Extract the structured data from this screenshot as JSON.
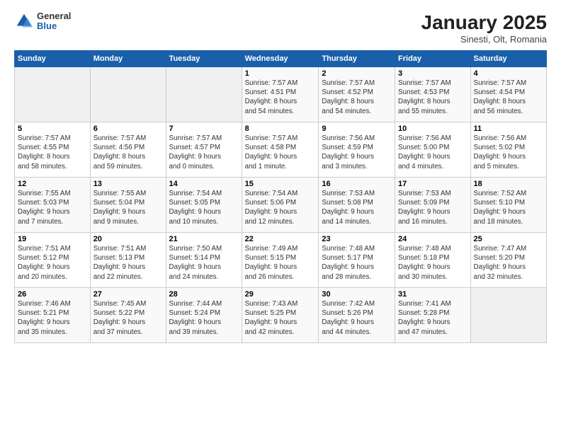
{
  "header": {
    "logo_general": "General",
    "logo_blue": "Blue",
    "month": "January 2025",
    "location": "Sinesti, Olt, Romania"
  },
  "weekdays": [
    "Sunday",
    "Monday",
    "Tuesday",
    "Wednesday",
    "Thursday",
    "Friday",
    "Saturday"
  ],
  "weeks": [
    [
      {
        "day": "",
        "info": ""
      },
      {
        "day": "",
        "info": ""
      },
      {
        "day": "",
        "info": ""
      },
      {
        "day": "1",
        "info": "Sunrise: 7:57 AM\nSunset: 4:51 PM\nDaylight: 8 hours\nand 54 minutes."
      },
      {
        "day": "2",
        "info": "Sunrise: 7:57 AM\nSunset: 4:52 PM\nDaylight: 8 hours\nand 54 minutes."
      },
      {
        "day": "3",
        "info": "Sunrise: 7:57 AM\nSunset: 4:53 PM\nDaylight: 8 hours\nand 55 minutes."
      },
      {
        "day": "4",
        "info": "Sunrise: 7:57 AM\nSunset: 4:54 PM\nDaylight: 8 hours\nand 56 minutes."
      }
    ],
    [
      {
        "day": "5",
        "info": "Sunrise: 7:57 AM\nSunset: 4:55 PM\nDaylight: 8 hours\nand 58 minutes."
      },
      {
        "day": "6",
        "info": "Sunrise: 7:57 AM\nSunset: 4:56 PM\nDaylight: 8 hours\nand 59 minutes."
      },
      {
        "day": "7",
        "info": "Sunrise: 7:57 AM\nSunset: 4:57 PM\nDaylight: 9 hours\nand 0 minutes."
      },
      {
        "day": "8",
        "info": "Sunrise: 7:57 AM\nSunset: 4:58 PM\nDaylight: 9 hours\nand 1 minute."
      },
      {
        "day": "9",
        "info": "Sunrise: 7:56 AM\nSunset: 4:59 PM\nDaylight: 9 hours\nand 3 minutes."
      },
      {
        "day": "10",
        "info": "Sunrise: 7:56 AM\nSunset: 5:00 PM\nDaylight: 9 hours\nand 4 minutes."
      },
      {
        "day": "11",
        "info": "Sunrise: 7:56 AM\nSunset: 5:02 PM\nDaylight: 9 hours\nand 5 minutes."
      }
    ],
    [
      {
        "day": "12",
        "info": "Sunrise: 7:55 AM\nSunset: 5:03 PM\nDaylight: 9 hours\nand 7 minutes."
      },
      {
        "day": "13",
        "info": "Sunrise: 7:55 AM\nSunset: 5:04 PM\nDaylight: 9 hours\nand 9 minutes."
      },
      {
        "day": "14",
        "info": "Sunrise: 7:54 AM\nSunset: 5:05 PM\nDaylight: 9 hours\nand 10 minutes."
      },
      {
        "day": "15",
        "info": "Sunrise: 7:54 AM\nSunset: 5:06 PM\nDaylight: 9 hours\nand 12 minutes."
      },
      {
        "day": "16",
        "info": "Sunrise: 7:53 AM\nSunset: 5:08 PM\nDaylight: 9 hours\nand 14 minutes."
      },
      {
        "day": "17",
        "info": "Sunrise: 7:53 AM\nSunset: 5:09 PM\nDaylight: 9 hours\nand 16 minutes."
      },
      {
        "day": "18",
        "info": "Sunrise: 7:52 AM\nSunset: 5:10 PM\nDaylight: 9 hours\nand 18 minutes."
      }
    ],
    [
      {
        "day": "19",
        "info": "Sunrise: 7:51 AM\nSunset: 5:12 PM\nDaylight: 9 hours\nand 20 minutes."
      },
      {
        "day": "20",
        "info": "Sunrise: 7:51 AM\nSunset: 5:13 PM\nDaylight: 9 hours\nand 22 minutes."
      },
      {
        "day": "21",
        "info": "Sunrise: 7:50 AM\nSunset: 5:14 PM\nDaylight: 9 hours\nand 24 minutes."
      },
      {
        "day": "22",
        "info": "Sunrise: 7:49 AM\nSunset: 5:15 PM\nDaylight: 9 hours\nand 26 minutes."
      },
      {
        "day": "23",
        "info": "Sunrise: 7:48 AM\nSunset: 5:17 PM\nDaylight: 9 hours\nand 28 minutes."
      },
      {
        "day": "24",
        "info": "Sunrise: 7:48 AM\nSunset: 5:18 PM\nDaylight: 9 hours\nand 30 minutes."
      },
      {
        "day": "25",
        "info": "Sunrise: 7:47 AM\nSunset: 5:20 PM\nDaylight: 9 hours\nand 32 minutes."
      }
    ],
    [
      {
        "day": "26",
        "info": "Sunrise: 7:46 AM\nSunset: 5:21 PM\nDaylight: 9 hours\nand 35 minutes."
      },
      {
        "day": "27",
        "info": "Sunrise: 7:45 AM\nSunset: 5:22 PM\nDaylight: 9 hours\nand 37 minutes."
      },
      {
        "day": "28",
        "info": "Sunrise: 7:44 AM\nSunset: 5:24 PM\nDaylight: 9 hours\nand 39 minutes."
      },
      {
        "day": "29",
        "info": "Sunrise: 7:43 AM\nSunset: 5:25 PM\nDaylight: 9 hours\nand 42 minutes."
      },
      {
        "day": "30",
        "info": "Sunrise: 7:42 AM\nSunset: 5:26 PM\nDaylight: 9 hours\nand 44 minutes."
      },
      {
        "day": "31",
        "info": "Sunrise: 7:41 AM\nSunset: 5:28 PM\nDaylight: 9 hours\nand 47 minutes."
      },
      {
        "day": "",
        "info": ""
      }
    ]
  ]
}
